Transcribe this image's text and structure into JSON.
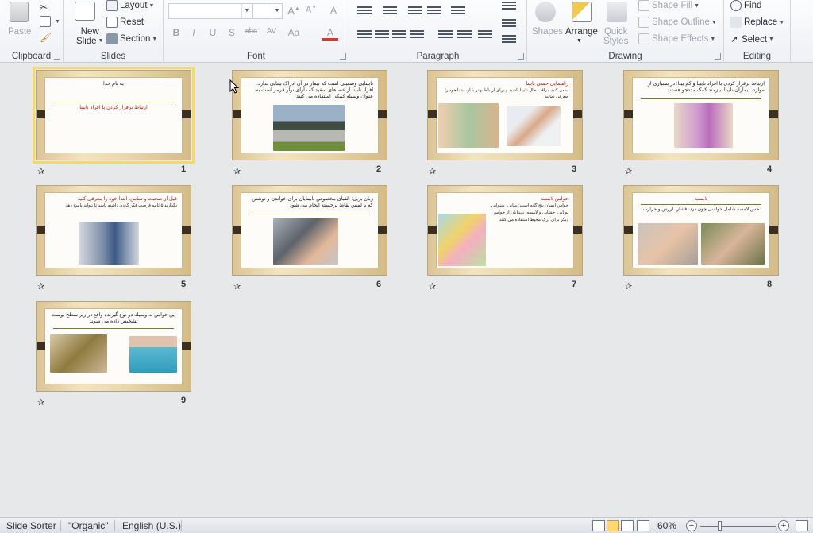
{
  "ribbon": {
    "clipboard": {
      "group_label": "Clipboard",
      "paste_label": "Paste"
    },
    "slides": {
      "group_label": "Slides",
      "new_slide_label": "New",
      "new_slide_label2": "Slide",
      "layout_label": "Layout",
      "reset_label": "Reset",
      "section_label": "Section"
    },
    "font": {
      "group_label": "Font",
      "font_name": "",
      "font_size": ""
    },
    "paragraph": {
      "group_label": "Paragraph"
    },
    "drawing": {
      "group_label": "Drawing",
      "shapes_label": "Shapes",
      "arrange_label": "Arrange",
      "quick_styles_label": "Quick",
      "quick_styles_label2": "Styles",
      "shape_fill_label": "Shape Fill",
      "shape_outline_label": "Shape Outline",
      "shape_effects_label": "Shape Effects"
    },
    "editing": {
      "group_label": "Editing",
      "find_label": "Find",
      "replace_label": "Replace",
      "select_label": "Select"
    }
  },
  "slides": [
    {
      "number": "1",
      "title": "به نام خدا",
      "subtitle": "ارتباط برقرار کردن با افراد نابینا"
    },
    {
      "number": "2",
      "title": "نابینایی وضعیتی است که بیمار در آن ادراک بینایی ندارد. افراد نابینا از عصاهای سفید که دارای نوار قرمز است به عنوان وسیله کمکی استفاده می کنند"
    },
    {
      "number": "3",
      "title": "راهنمایی حسی نابینا",
      "body": "سعی کنید مراقب حال نابینا باشید و برای ارتباط بهتر با او، ابتدا خود را معرفی نمایید"
    },
    {
      "number": "4",
      "title": "ارتباط برقرار کردن با افراد نابینا و کم بینا: در بسیاری از موارد، بیماران نابینا نیازمند کمک مددجو هستند"
    },
    {
      "number": "5",
      "title": "قبل از صحبت و تماس، ابتدا خود را معرفی کنید",
      "body": "بگذارید ۵ ثانیه فرصت فکر کردن داشته باشد تا بتواند پاسخ دهد"
    },
    {
      "number": "6",
      "title": "زبان بریل: الفبای مخصوص نابینایان برای خواندن و نوشتن که با لمس نقاط برجسته انجام می شود"
    },
    {
      "number": "7",
      "title": "حواس لامسه",
      "body": "حواس انسان پنج گانه است: بینایی، شنوایی، بویایی، چشایی و لامسه. نابینایان از حواس دیگر برای درک محیط استفاده می کنند"
    },
    {
      "number": "8",
      "title": "لامسه",
      "body": "حس لامسه شامل حواسی چون درد، فشار، لرزش و حرارت"
    },
    {
      "number": "9",
      "title": "این حواس به وسیله دو نوع گیرنده واقع در زیر سطح پوست تشخیص داده می شوند"
    }
  ],
  "status": {
    "view": "Slide Sorter",
    "theme": "\"Organic\"",
    "language": "English (U.S.)",
    "zoom": "60%",
    "zoom_level": 0.6
  }
}
